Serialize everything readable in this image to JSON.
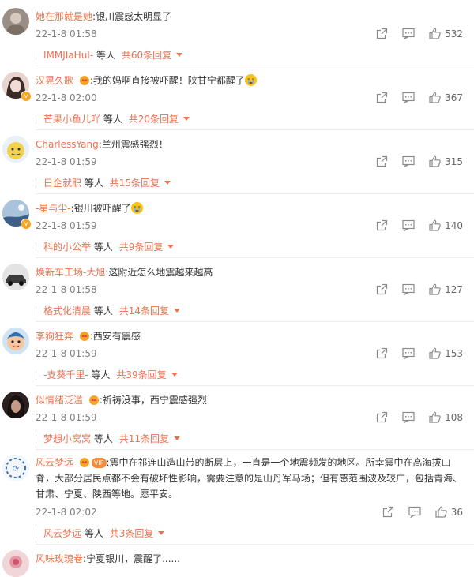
{
  "comments": [
    {
      "user": "她在那就是她",
      "text": "银川震感太明显了",
      "time": "22-1-8 01:58",
      "likes": "532",
      "reply_user": "IMMJIaHuI-",
      "reply_mid": "等人",
      "reply_more": "共60条回复",
      "avatar_color": "#9a8f86",
      "emoji": ""
    },
    {
      "user": "汉晃久歌",
      "text": "我的妈啊直接被吓醒！陕甘宁都醒了",
      "time": "22-1-8 02:00",
      "likes": "367",
      "reply_user": "芒果小鱼儿吖",
      "reply_mid": "等人",
      "reply_more": "共20条回复",
      "avatar_color": "#d9b8b4",
      "emoji": "cry",
      "badge": "v"
    },
    {
      "user": "CharlessYang",
      "text": "兰州震感强烈！",
      "time": "22-1-8 01:59",
      "likes": "315",
      "reply_user": "日企就职",
      "reply_mid": "等人",
      "reply_more": "共15条回复",
      "avatar_color": "#f2d14c",
      "emoji": ""
    },
    {
      "user": "-星与尘-",
      "text": "银川被吓醒了",
      "time": "22-1-8 01:59",
      "likes": "140",
      "reply_user": "科的小公举",
      "reply_mid": "等人",
      "reply_more": "共9条回复",
      "avatar_color": "#7f9fc3",
      "emoji": "cry",
      "badge": "v"
    },
    {
      "user": "焕新车工场-大旭",
      "text": "这附近怎么地震越来越高",
      "time": "22-1-8 01:58",
      "likes": "127",
      "reply_user": "格式化清晨",
      "reply_mid": "等人",
      "reply_more": "共14条回复",
      "avatar_color": "#5a5a5a",
      "emoji": ""
    },
    {
      "user": "李狗狂奔",
      "text": "西安有震感",
      "time": "22-1-8 01:59",
      "likes": "153",
      "reply_user": "-支葵千里-",
      "reply_mid": "等人",
      "reply_more": "共39条回复",
      "avatar_color": "#f0c35a",
      "emoji": "",
      "crown": true
    },
    {
      "user": "似情绪泛滥",
      "text": "祈祷没事，西宁震感强烈",
      "time": "22-1-8 01:59",
      "likes": "108",
      "reply_user": "梦想小窝窝",
      "reply_mid": "等人",
      "reply_more": "共11条回复",
      "avatar_color": "#3a2a26",
      "emoji": "",
      "crown": true
    },
    {
      "user": "风云梦远",
      "text": "震中在祁连山造山带的断层上，一直是一个地震频发的地区。所幸震中在高海拔山脊，大部分居民点都不会有破坏性影响，需要注意的是山丹军马场；但有感范围波及较广，包括青海、甘肃、宁夏、陕西等地。愿平安。",
      "time": "22-1-8 02:02",
      "likes": "36",
      "reply_user": "风云梦远",
      "reply_mid": "等人",
      "reply_more": "共3条回复",
      "avatar_color": "#dfe8f5",
      "emoji": "",
      "vip": true,
      "vip_label": "VIP"
    },
    {
      "user": "风味玫瑰卷",
      "text": "宁夏银川，震醒了......",
      "time": "",
      "likes": "",
      "reply_user": "",
      "reply_mid": "",
      "reply_more": "",
      "avatar_color": "#e9c4c8",
      "emoji": ""
    }
  ]
}
